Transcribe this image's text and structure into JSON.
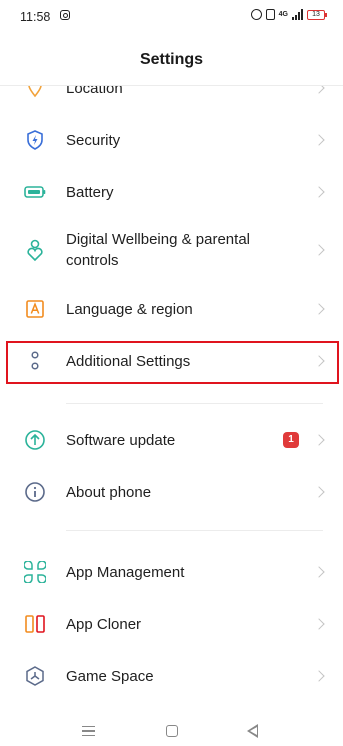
{
  "status_bar": {
    "time": "11:58",
    "network": "4G",
    "battery": "13"
  },
  "header": {
    "title": "Settings"
  },
  "items": [
    {
      "label": "Location",
      "icon": "location-icon"
    },
    {
      "label": "Security",
      "icon": "shield-icon"
    },
    {
      "label": "Battery",
      "icon": "battery-icon"
    },
    {
      "label": "Digital Wellbeing & parental controls",
      "icon": "wellbeing-icon"
    },
    {
      "label": "Language & region",
      "icon": "language-icon"
    },
    {
      "label": "Additional Settings",
      "icon": "more-icon"
    },
    {
      "label": "Software update",
      "icon": "update-icon",
      "badge": "1"
    },
    {
      "label": "About phone",
      "icon": "info-icon"
    },
    {
      "label": "App Management",
      "icon": "apps-icon"
    },
    {
      "label": "App Cloner",
      "icon": "cloner-icon"
    },
    {
      "label": "Game Space",
      "icon": "game-icon"
    }
  ],
  "colors": {
    "highlight": "#e0141e",
    "badge": "#e03a3a",
    "accent_green": "#2bb39a",
    "accent_blue": "#3a6fd8",
    "accent_orange": "#f28c1f"
  }
}
